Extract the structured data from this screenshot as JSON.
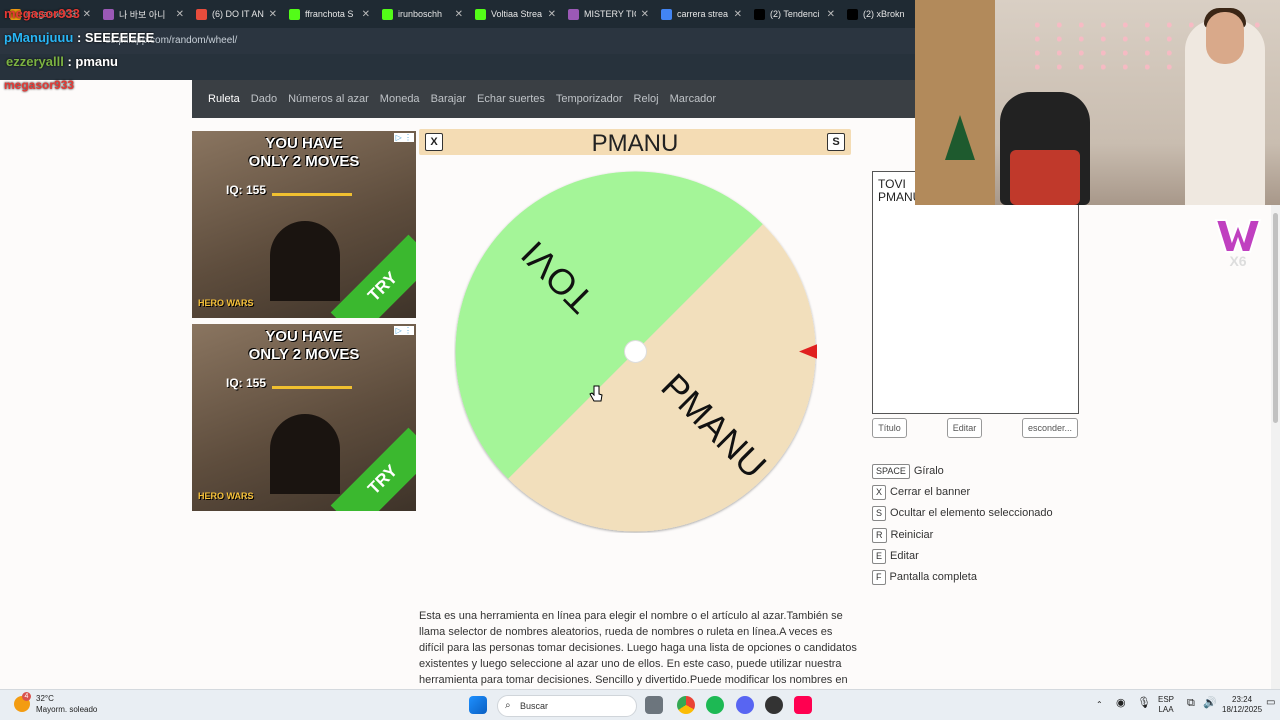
{
  "browser": {
    "tabs": [
      {
        "label": "megasor933",
        "color": "#f39c12"
      },
      {
        "label": "나 바보 아니",
        "color": "#9b59b6"
      },
      {
        "label": "(6) DO IT AN",
        "color": "#e74c3c"
      },
      {
        "label": "ffranchota S",
        "color": "#53fc18"
      },
      {
        "label": "irunboschh",
        "color": "#53fc18"
      },
      {
        "label": "Voltiaa Strea",
        "color": "#53fc18"
      },
      {
        "label": "MISTERY TIC",
        "color": "#9b59b6"
      },
      {
        "label": "carrera strea",
        "color": "#4285f4"
      },
      {
        "label": "(2) Tendenci",
        "color": "#000000"
      },
      {
        "label": "(2) xBrokn",
        "color": "#000000"
      }
    ],
    "url": "es.piliapp.com/random/wheel/"
  },
  "chat": [
    {
      "user": "megasor933",
      "message": "",
      "color": "#e53935"
    },
    {
      "user": "pManujuuu",
      "message": "SEEEEEEE",
      "color": "#29b6f6"
    },
    {
      "user": "ezzeryalll",
      "message": "pmanu",
      "color": "#7cb342"
    },
    {
      "user": "megasor933",
      "message": "",
      "color": "#e53935"
    }
  ],
  "nav": {
    "items": [
      "Ruleta",
      "Dado",
      "Números al azar",
      "Moneda",
      "Barajar",
      "Echar suertes",
      "Temporizador",
      "Reloj",
      "Marcador"
    ],
    "active": 0
  },
  "ads": [
    {
      "headline_1": "YOU HAVE",
      "headline_2": "ONLY 2 MOVES",
      "iq": "IQ: 155",
      "cta": "TRY",
      "brand": "HERO WARS"
    },
    {
      "headline_1": "YOU HAVE",
      "headline_2": "ONLY 2 MOVES",
      "iq": "IQ: 155",
      "cta": "TRY",
      "brand": "HERO WARS"
    }
  ],
  "wheel": {
    "title": "PMANU",
    "close_key": "X",
    "hide_key": "S",
    "segments": [
      {
        "label": "TOVI",
        "color": "#a4f598"
      },
      {
        "label": "PMANU",
        "color": "#f2dfbc"
      }
    ],
    "pointer_color": "#e02020"
  },
  "editor": {
    "text": "TOVI\nPMANU",
    "buttons": {
      "title": "Título",
      "edit": "Editar",
      "hide": "esconder..."
    }
  },
  "shortcuts": [
    {
      "key": "SPACE",
      "label": "Gíralo"
    },
    {
      "key": "X",
      "label": "Cerrar el banner"
    },
    {
      "key": "S",
      "label": "Ocultar el elemento seleccionado"
    },
    {
      "key": "R",
      "label": "Reiniciar"
    },
    {
      "key": "E",
      "label": "Editar"
    },
    {
      "key": "F",
      "label": "Pantalla completa"
    }
  ],
  "description": "Esta es una herramienta en línea para elegir el nombre o el artículo al azar.También se llama selector de nombres aleatorios, rueda de nombres o ruleta en línea.A veces es difícil para las personas tomar decisiones. Luego haga una lista de opciones o candidatos existentes y luego seleccione al azar uno de ellos. En este caso, puede utilizar nuestra herramienta para tomar decisiones. Sencillo y divertido.Puede modificar los nombres en textarea, poner un",
  "taskbar": {
    "weather_temp": "32°C",
    "weather_desc": "Mayorm. soleado",
    "weather_badge": "4",
    "search_placeholder": "Buscar",
    "lang_1": "ESP",
    "lang_2": "LAA",
    "time": "23:24",
    "date": "18/12/2025"
  }
}
